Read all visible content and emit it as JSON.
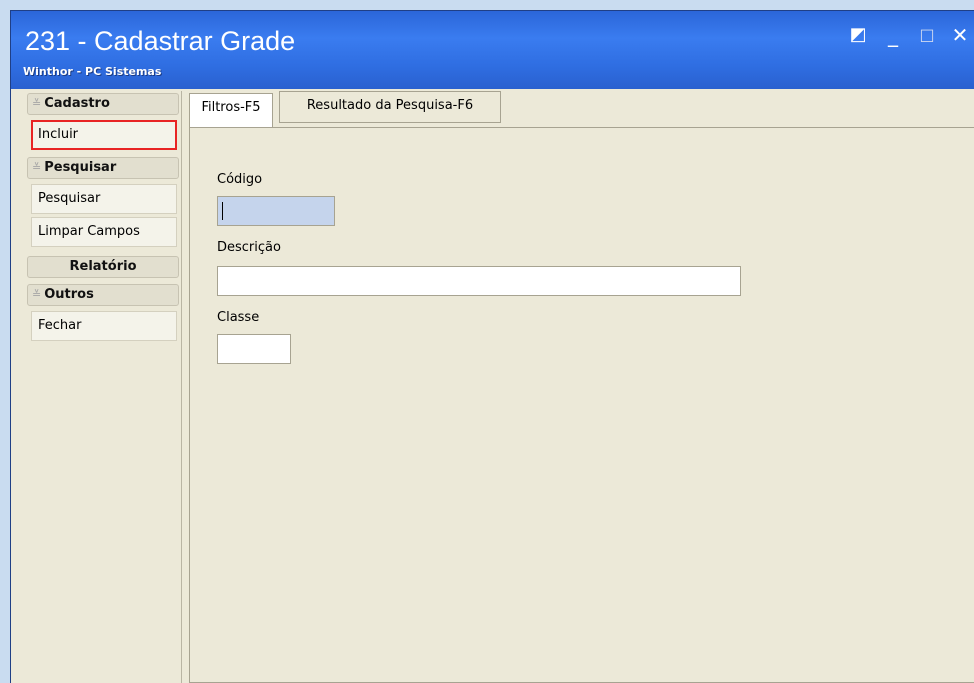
{
  "window": {
    "title": "231 - Cadastrar Grade",
    "subtitle": "Winthor - PC Sistemas",
    "controls": {
      "restore": "◩",
      "minimize": "_",
      "maximize": "□",
      "close": "✕"
    }
  },
  "sidebar": {
    "groups": [
      {
        "chevron": "≚",
        "label": "Cadastro",
        "items": [
          {
            "label": "Incluir"
          }
        ]
      },
      {
        "chevron": "≚",
        "label": "Pesquisar",
        "items": [
          {
            "label": "Pesquisar"
          },
          {
            "label": "Limpar Campos"
          }
        ]
      },
      {
        "chevron": "",
        "label": "Relatório",
        "items": []
      },
      {
        "chevron": "≚",
        "label": "Outros",
        "items": [
          {
            "label": "Fechar"
          }
        ]
      }
    ]
  },
  "tabs": [
    {
      "label": "Filtros-F5",
      "active": true
    },
    {
      "label": "Resultado da Pesquisa-F6",
      "active": false
    }
  ],
  "form": {
    "codigo": {
      "label": "Código",
      "value": ""
    },
    "descricao": {
      "label": "Descrição",
      "value": ""
    },
    "classe": {
      "label": "Classe",
      "value": ""
    }
  },
  "colors": {
    "titlebar": "#2f6ee2",
    "window_bg": "#ece9d8",
    "highlight_border": "#e82424",
    "focused_field": "#c5d4ec"
  }
}
